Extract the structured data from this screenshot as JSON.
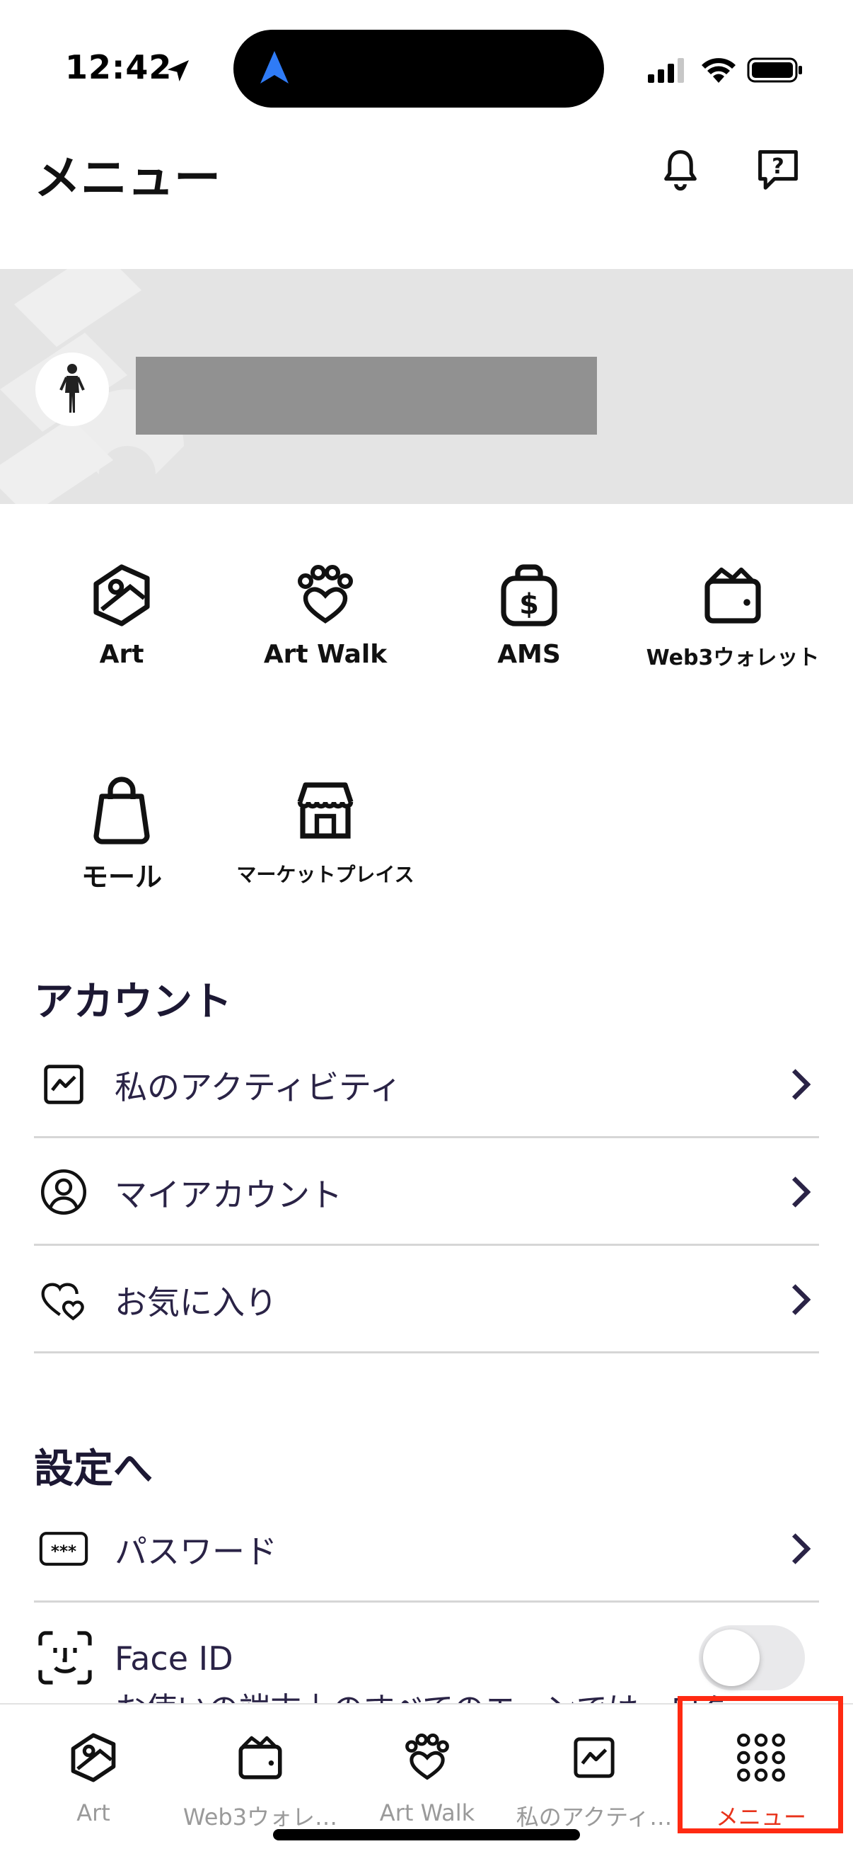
{
  "status_bar": {
    "time": "12:42"
  },
  "header": {
    "title": "メニュー"
  },
  "quick_links": [
    {
      "label": "Art",
      "icon": "art-icon"
    },
    {
      "label": "Art Walk",
      "icon": "paw-heart-icon"
    },
    {
      "label": "AMS",
      "icon": "money-bag-icon"
    },
    {
      "label": "Web3ウォレット",
      "icon": "wallet-icon"
    },
    {
      "label": "モール",
      "icon": "shopping-bag-icon"
    },
    {
      "label": "マーケットプレイス",
      "icon": "storefront-icon"
    }
  ],
  "account": {
    "title": "アカウント",
    "items": [
      {
        "label": "私のアクティビティ",
        "icon": "activity-chart-icon"
      },
      {
        "label": "マイアカウント",
        "icon": "user-circle-icon"
      },
      {
        "label": "お気に入り",
        "icon": "hearts-icon"
      }
    ]
  },
  "settings": {
    "title": "設定へ",
    "items": [
      {
        "label": "パスワード",
        "icon": "password-icon"
      }
    ],
    "face_id": {
      "label": "Face ID",
      "enabled": false,
      "description_partial": "お使いの端末上のすべてのエーンでは…ログイ"
    }
  },
  "tab_bar": {
    "tabs": [
      {
        "label": "Art",
        "icon": "art-icon"
      },
      {
        "label": "Web3ウォレ…",
        "icon": "wallet-icon"
      },
      {
        "label": "Art Walk",
        "icon": "paw-heart-icon"
      },
      {
        "label": "私のアクティ…",
        "icon": "activity-chart-icon"
      },
      {
        "label": "メニュー",
        "icon": "grid-dots-icon",
        "active": true
      }
    ]
  },
  "colors": {
    "accent_active": "#e8321a",
    "highlight_border": "#ff2a12",
    "banner_bg": "#e4e4e4",
    "section_text": "#1c1833",
    "nav_blue": "#2f7bf6"
  }
}
